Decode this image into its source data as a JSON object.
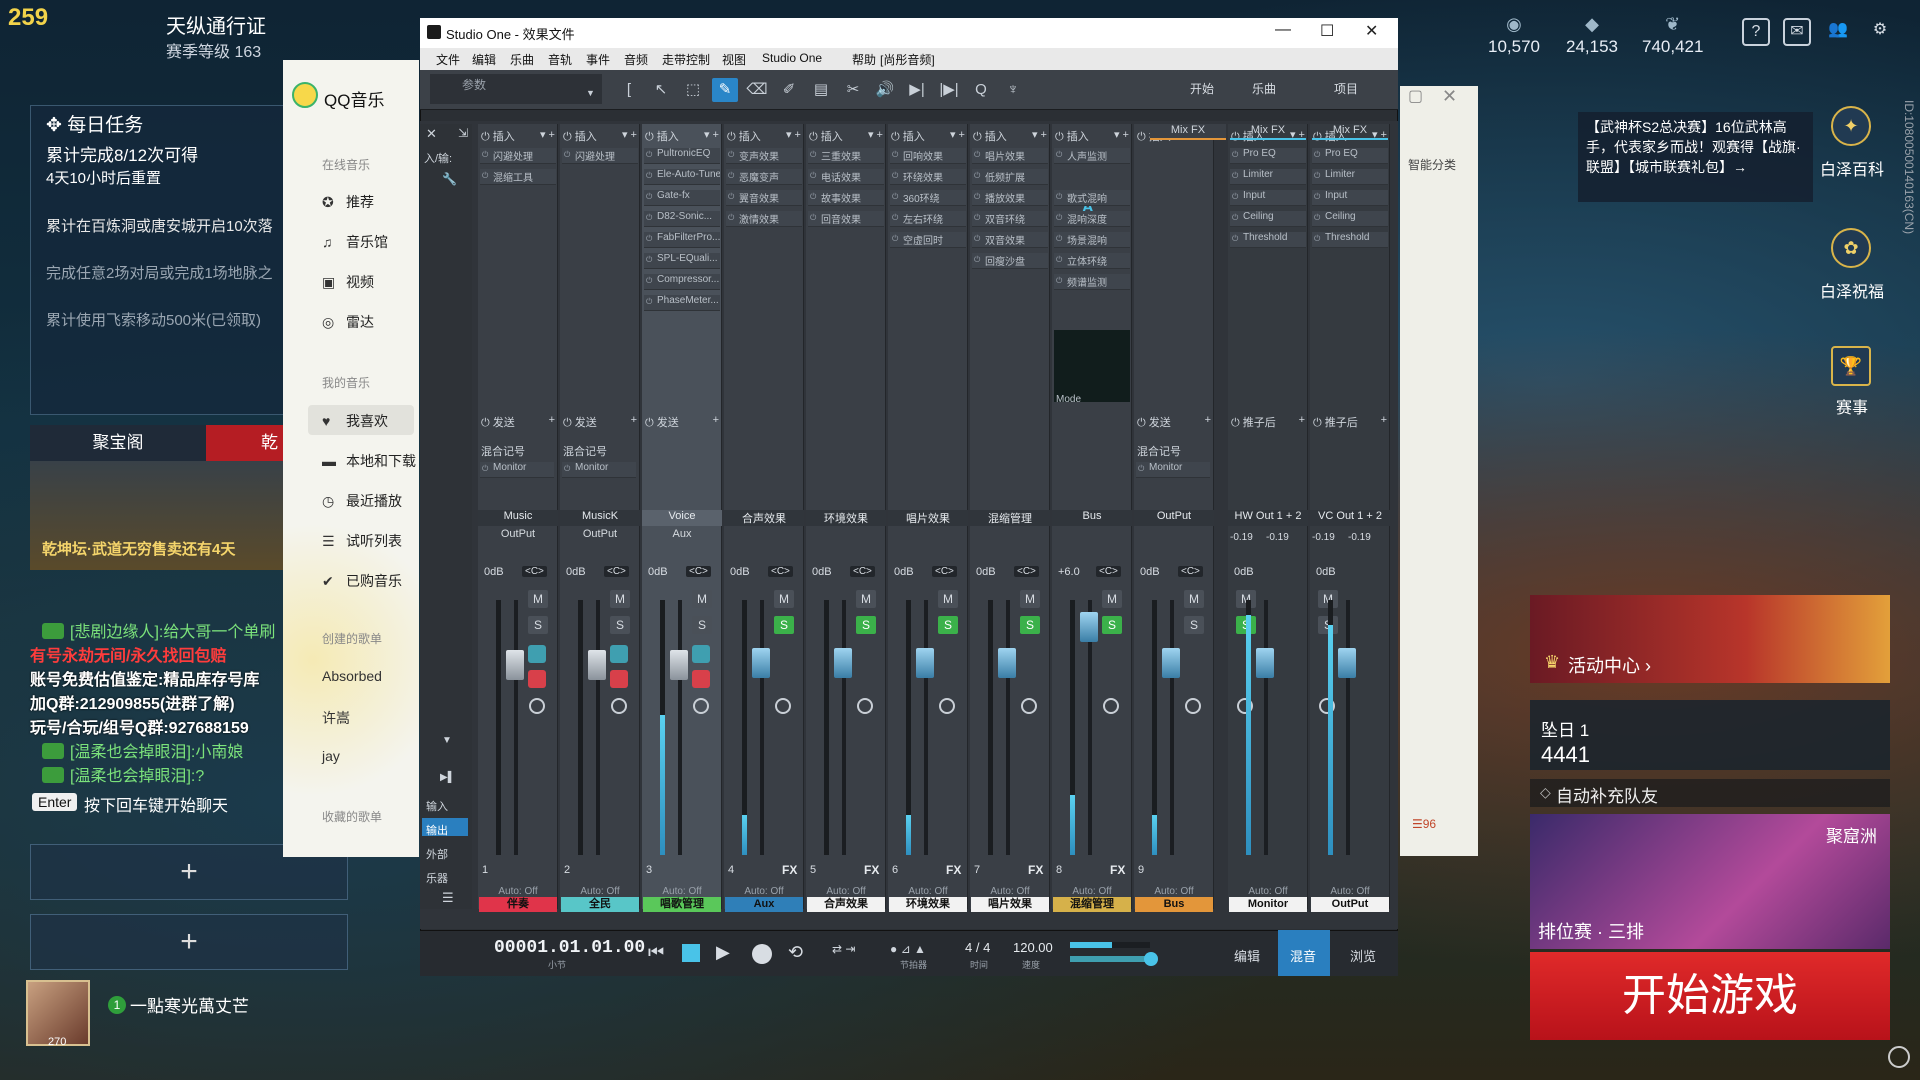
{
  "game": {
    "level": "259",
    "pass_title": "天纵通行证",
    "pass_level": "赛季等级 163",
    "currencies": [
      "10,570",
      "24,153",
      "740,421"
    ],
    "daily": {
      "title": "每日任务",
      "progress": "累计完成8/12次可得",
      "reset": "4天10小时后重置",
      "tasks": [
        "累计在百炼洞或唐安城开启10次落",
        "完成任意2场对局或完成1场地脉之",
        "累计使用飞索移动500米(已领取)"
      ]
    },
    "treasure": {
      "tab": "聚宝阁",
      "tab2": "乾",
      "text": "乾坤坛·武道无穷售卖还有4天"
    },
    "chat": [
      {
        "text": "[悲剧边缘人]:给大哥一个单刷",
        "cls": "green"
      },
      {
        "text": "有号永劫无间/永久找回包赔",
        "cls": "red"
      },
      {
        "text": "账号免费估值鉴定:精品库存号库",
        "cls": "white"
      },
      {
        "text": "加Q群:212909855(进群了解)",
        "cls": "white"
      },
      {
        "text": "玩号/合玩/组号Q群:927688159",
        "cls": "white"
      },
      {
        "text": "[温柔也会掉眼泪]:小南娘",
        "cls": "green"
      },
      {
        "text": "[温柔也会掉眼泪]:?",
        "cls": "green"
      }
    ],
    "enter_key": "Enter",
    "enter_hint": "按下回车键开始聊天",
    "plus": "+",
    "player": {
      "num": "1",
      "name": "一點寒光萬丈芒",
      "level": "270"
    },
    "announce": "【武神杯S2总决赛】16位武林高手，代表家乡而战！观赛得【战旗·联盟】【城市联赛礼包】→",
    "right_links": [
      "白泽百科",
      "白泽祝福",
      "赛事"
    ],
    "vertical_id": "ID:10800500140163(CN)",
    "event": "活动中心 ›",
    "rank": {
      "name": "坠日 1",
      "score": "4441"
    },
    "autofill": "自动补充队友",
    "mode": {
      "name": "聚窟洲",
      "label": "排位赛 · 三排"
    },
    "start": "开始游戏"
  },
  "qq": {
    "logo": "QQ音乐",
    "online": "在线音乐",
    "items": [
      "推荐",
      "音乐馆",
      "视频",
      "雷达"
    ],
    "my": "我的音乐",
    "my_items": [
      "我喜欢",
      "本地和下载",
      "最近播放",
      "试听列表",
      "已购音乐"
    ],
    "created": "创建的歌单",
    "lists": [
      "Absorbed",
      "许嵩",
      "jay"
    ],
    "collected": "收藏的歌单",
    "side_text": "智能分类"
  },
  "so": {
    "title": "Studio One - 效果文件",
    "menus": [
      "文件",
      "编辑",
      "乐曲",
      "音轨",
      "事件",
      "音频",
      "走带控制",
      "视图",
      "Studio One",
      "帮助",
      "[尚彤音频]"
    ],
    "param": "参数",
    "tabs": [
      "开始",
      "乐曲",
      "项目"
    ],
    "bottom_tabs": [
      "编辑",
      "混音",
      "浏览"
    ],
    "time": "00001.01.01.00",
    "time_sub": "小节",
    "sig": "4 / 4",
    "sig_sub": "时间",
    "tempo": "120.00",
    "tempo_sub": "速度",
    "metro": "节拍器",
    "left_buttons": [
      "输入",
      "输出",
      "外部",
      "乐器"
    ],
    "input_label": "入/输:",
    "strips": [
      {
        "ins": "插入",
        "fx": [
          "闪避处理",
          "混缩工具"
        ],
        "send": "发送",
        "rec": "混合记号",
        "mon": "Monitor",
        "name": "Music",
        "out": "OutPut",
        "gain": "0dB",
        "num": "1",
        "label": "伴奏",
        "color": "#e0344a"
      },
      {
        "ins": "插入",
        "fx": [
          "闪避处理"
        ],
        "send": "发送",
        "rec": "混合记号",
        "mon": "Monitor",
        "name": "MusicK",
        "out": "OutPut",
        "gain": "0dB",
        "num": "2",
        "label": "全民",
        "color": "#58c6c8"
      },
      {
        "ins": "插入",
        "fx": [
          "PultronicEQ",
          "Ele-Auto-Tune",
          "Gate-fx",
          "D82-Sonic...",
          "FabFilterPro...",
          "SPL-EQuali...",
          "Compressor...",
          "PhaseMeter..."
        ],
        "send": "发送",
        "name": "Voice",
        "out": "Aux",
        "gain": "0dB",
        "num": "3",
        "label": "唱歌管理",
        "color": "#5ac85a"
      },
      {
        "ins": "插入",
        "fx": [
          "变声效果",
          "恶魔变声",
          "翼音效果",
          "激情效果"
        ],
        "name": "合声效果",
        "gain": "0dB",
        "num": "4",
        "fxl": "FX",
        "label": "Aux",
        "color": "#2f7fb8"
      },
      {
        "ins": "插入",
        "fx": [
          "三重效果",
          "电话效果",
          "故事效果",
          "回音效果"
        ],
        "name": "环境效果",
        "gain": "0dB",
        "num": "5",
        "fxl": "FX",
        "label": "合声效果",
        "color": "#f2f2f2"
      },
      {
        "ins": "插入",
        "fx": [
          "回响效果",
          "环绕效果",
          "360环绕",
          "左右环绕",
          "空虚回时"
        ],
        "name": "唱片效果",
        "gain": "0dB",
        "num": "6",
        "fxl": "FX",
        "label": "环境效果",
        "color": "#f2f2f2"
      },
      {
        "ins": "插入",
        "fx": [
          "唱片效果",
          "低频扩展",
          "播放效果",
          "双音环绕",
          "双音效果",
          "回瘦沙盘"
        ],
        "name": "混缩管理",
        "gain": "0dB",
        "num": "7",
        "fxl": "FX",
        "label": "唱片效果",
        "color": "#f2f2f2"
      },
      {
        "ins": "插入",
        "fx": [
          "人声监测",
          "A",
          "歌式混响",
          "混响深度",
          "场景混响",
          "立体环绕",
          "频谱监测"
        ],
        "name": "Bus",
        "gain": "+6.0",
        "num": "8",
        "fxl": "FX",
        "label": "混缩管理",
        "color": "#d6b14a"
      },
      {
        "ins": "插入",
        "fx": [],
        "send": "发送",
        "rec": "混合记号",
        "mon": "Monitor",
        "name": "OutPut",
        "gain": "0dB",
        "num": "9",
        "label": "Bus",
        "color": "#e3963a"
      },
      {
        "ins": "插入",
        "fx": [
          "Pro EQ",
          "Limiter",
          "Input",
          "Ceiling",
          "Threshold"
        ],
        "send": "推子后",
        "name": "HW Out 1 + 2",
        "gain": "0dB",
        "label": "Monitor",
        "color": "#f2f2f2"
      },
      {
        "ins": "插入",
        "fx": [
          "Pro EQ",
          "Limiter",
          "Input",
          "Ceiling",
          "Threshold"
        ],
        "send": "推子后",
        "name": "VC Out 1 + 2",
        "gain": "0dB",
        "label": "OutPut",
        "color": "#f2f2f2"
      }
    ],
    "mixfx": "Mix FX",
    "mode": "Mode",
    "auto": "Auto: Off",
    "db_neg": "-0.19",
    "m": "M",
    "s": "S"
  },
  "qq_right": {
    "count": "☰96"
  }
}
